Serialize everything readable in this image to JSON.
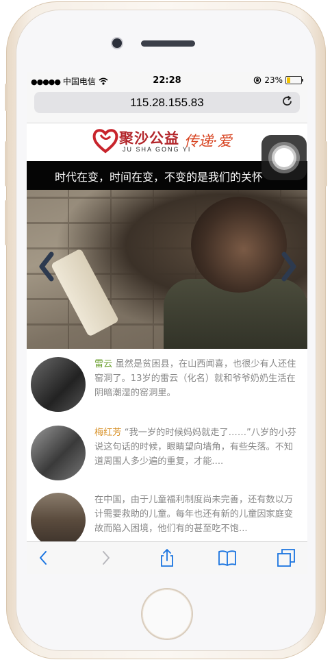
{
  "status_bar": {
    "signal_dots": "●●●●●",
    "carrier": "中国电信",
    "time": "22:28",
    "battery_percent": "23%",
    "battery_level": 0.23
  },
  "browser": {
    "url": "115.28.155.83"
  },
  "site": {
    "logo_cn": "聚沙公益",
    "logo_en": "JU SHA GONG YI",
    "logo_slogan": "传递·爱",
    "banner_text": "时代在变，时间在变，不变的是我们的关怀"
  },
  "articles": [
    {
      "name": "雷云",
      "text": " 虽然是贫困县，在山西闻喜，也很少有人还住窑洞了。13岁的雷云（化名）就和爷爷奶奶生活在阴暗潮湿的窑洞里。"
    },
    {
      "name": "梅红芳",
      "text": " “我一岁的时候妈妈就走了……”八岁的小芬说这句话的时候，眼睛望向墙角，有些失落。不知道周围人多少遍的重复，才能...."
    },
    {
      "name": "",
      "text": "在中国，由于儿童福利制度尚未完善，还有数以万计需要救助的儿童。每年也还有新的儿童因家庭变故而陷入困境，他们有的甚至吃不饱..."
    }
  ],
  "colors": {
    "name_green": "#6fa234",
    "name_orange": "#d8922a",
    "safari_blue": "#1a74e0",
    "logo_red": "#b3262b"
  },
  "icons": {
    "back": "chevron-left-icon",
    "forward": "chevron-right-icon",
    "share": "share-icon",
    "bookmarks": "book-icon",
    "tabs": "tabs-icon",
    "reload": "reload-icon"
  }
}
